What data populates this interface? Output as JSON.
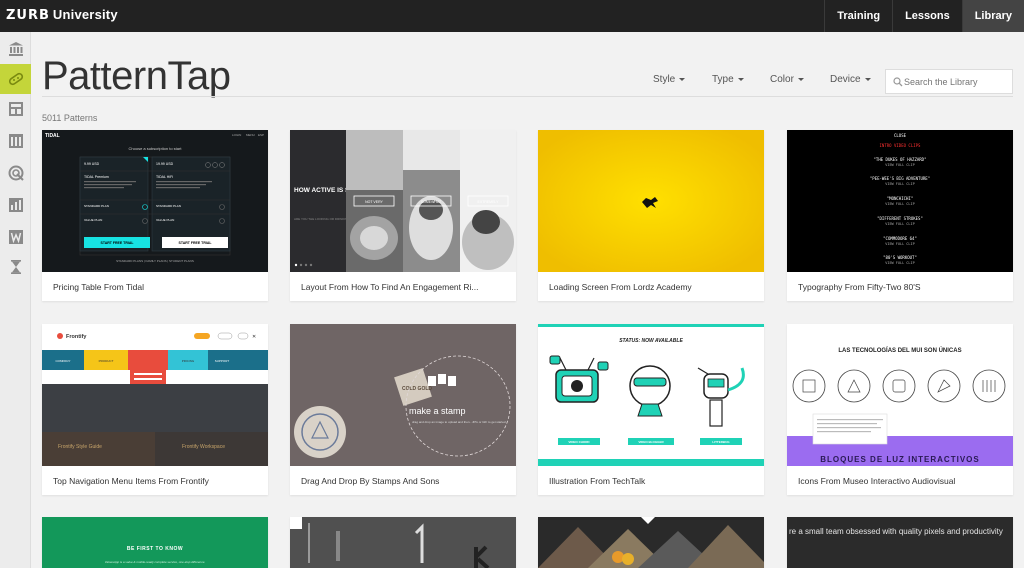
{
  "topbar": {
    "brand_mark": "ZURB",
    "brand_name": "University",
    "nav": [
      "Training",
      "Lessons",
      "Library"
    ]
  },
  "leftbar": {
    "icons": [
      "library-icon",
      "pattern-icon",
      "layout-icon",
      "column-icon",
      "target-icon",
      "chart-icon",
      "w-icon",
      "hourglass-icon"
    ],
    "accent": "#c4d53a"
  },
  "page": {
    "title": "PatternTap",
    "count": "5011 Patterns"
  },
  "filters": [
    "Style",
    "Type",
    "Color",
    "Device"
  ],
  "search": {
    "placeholder": "Search the Library"
  },
  "cards": [
    {
      "caption": "Pricing Table From Tidal"
    },
    {
      "caption": "Layout From How To Find An Engagement Ri..."
    },
    {
      "caption": "Loading Screen From Lordz Academy"
    },
    {
      "caption": "Typography From Fifty-Two 80'S"
    },
    {
      "caption": "Top Navigation Menu Items From Frontify"
    },
    {
      "caption": "Drag And Drop By Stamps And Sons"
    },
    {
      "caption": "Illustration From TechTalk"
    },
    {
      "caption": "Icons From Museo Interactivo Audiovisual"
    },
    {
      "caption": ""
    },
    {
      "caption": ""
    },
    {
      "caption": ""
    },
    {
      "caption": ""
    }
  ],
  "thumbs": {
    "tidal": {
      "logo": "TIDAL",
      "nav": [
        "LOGIN",
        "MENU",
        "ESP"
      ],
      "heading": "Choose a subscription to start",
      "plan_a": "TIDAL Premium",
      "plan_b": "TIDAL HiFi",
      "price_a": "9.99 USD",
      "price_b": "19.99 USD",
      "rows": [
        "STANDARD PLAN",
        "VALUE PLAN"
      ],
      "btn_a": "START FREE TRIAL",
      "btn_b": "START FREE TRIAL",
      "footer": "STANDARD PLANS  |  FAMILY PLANS  |  STUDENT PLANS"
    },
    "cats": {
      "headline": "HOW ACTIVE IS SHE ON A TYPICAL DAY?",
      "sub": "ARE YOU THE LOOKING OR DRINKING TYPE?",
      "labels": [
        "NOT VERY",
        "SOMEWHAT",
        "EXTREMELY"
      ]
    },
    "retro": {
      "heading": "CLOSE",
      "items": [
        "INTRO VIDEO CLIPS",
        "\"THE DUKES OF HAZZARD\"",
        "\"PEE-WEE'S BIG ADVENTURE\"",
        "\"MONCHICHI\"",
        "\"DIFFERENT STROKES\"",
        "\"COMMODORE 64\"",
        "\"80'S WORKOUT\""
      ],
      "sub": "VIEW FULL CLIP"
    },
    "frontify": {
      "logo": "Frontify",
      "menu": [
        "COMPANY",
        "PRODUCT",
        "PRICING",
        "SUPPORT"
      ],
      "dropdown": [
        "BRAND GUIDES",
        "WORKSPACE",
        "STYLE GUIDES"
      ],
      "bottom_a": "Frontify Style Guide",
      "bottom_b": "Frontify Workspace"
    },
    "stamp": {
      "headline": "make a stamp",
      "sub": "drag and drop an image to upload and then...JPG or GIF to get started",
      "badge": "COLD GOLD"
    },
    "tech": {
      "status": "STATUS: NOW AVAILABLE",
      "buttons": [
        "VIDEO CHORD",
        "VIDEO BLOGGER",
        "LITTERBUG"
      ]
    },
    "museo": {
      "heading": "LAS TECNOLOGÍAS DEL MUI SON ÚNICAS",
      "banner": "BLOQUES DE LUZ INTERACTIVOS"
    },
    "green": {
      "heading": "BE FIRST TO KNOW",
      "text": "ValuesApp is a value & mobile-ready complete service, one-stop difference."
    },
    "dark": {
      "text": "re a small team obsessed with quality pixels and productivity"
    }
  }
}
